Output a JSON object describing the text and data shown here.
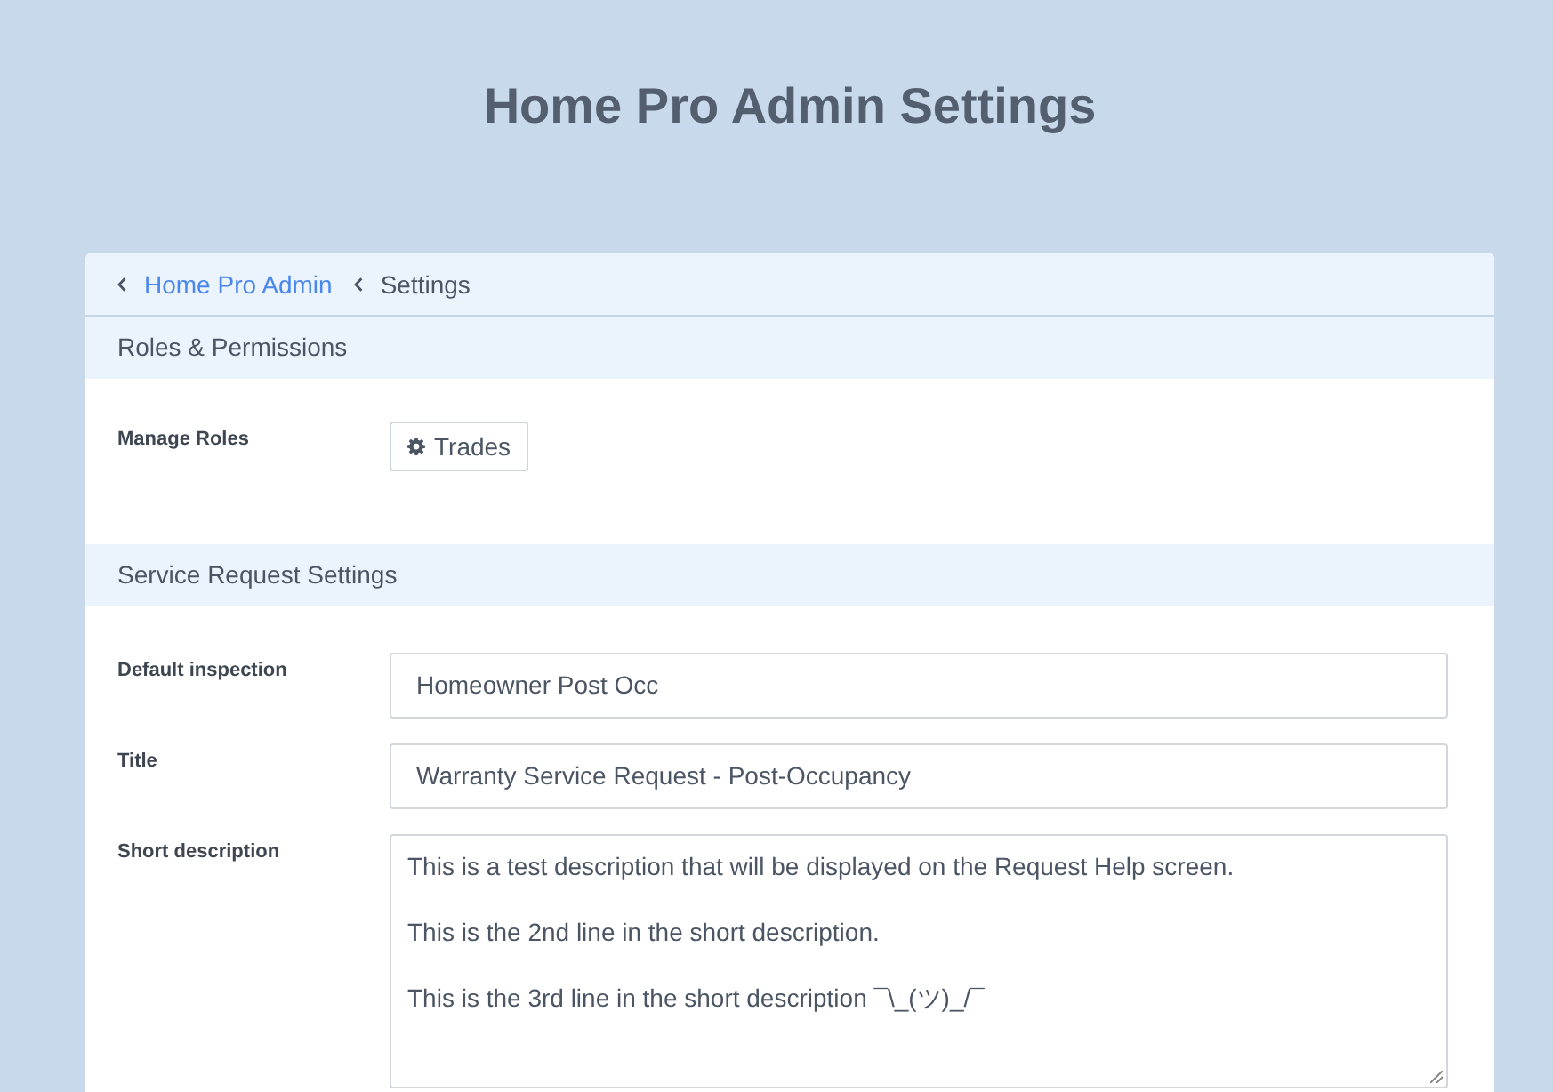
{
  "page": {
    "title": "Home Pro Admin Settings"
  },
  "breadcrumb": [
    {
      "label": "Home Pro Admin",
      "kind": "link"
    },
    {
      "label": "Settings",
      "kind": "current"
    }
  ],
  "sections": [
    {
      "heading": "Roles & Permissions",
      "rows": [
        {
          "label": "Manage Roles",
          "kind": "buttons",
          "buttons": [
            {
              "label": "Trades"
            }
          ]
        }
      ]
    },
    {
      "heading": "Service Request Settings",
      "rows": [
        {
          "label": "Default inspection",
          "kind": "input",
          "value": "Homeowner Post Occ"
        },
        {
          "label": "Title",
          "kind": "input",
          "value": "Warranty Service Request - Post-Occupancy"
        },
        {
          "label": "Short description",
          "kind": "textarea",
          "value": "This is a test description that will be displayed on the Request Help screen.\n\nThis is the 2nd line in the short description.\n\nThis is the 3rd line in the short description ¯\\_(ツ)_/¯"
        }
      ]
    }
  ]
}
